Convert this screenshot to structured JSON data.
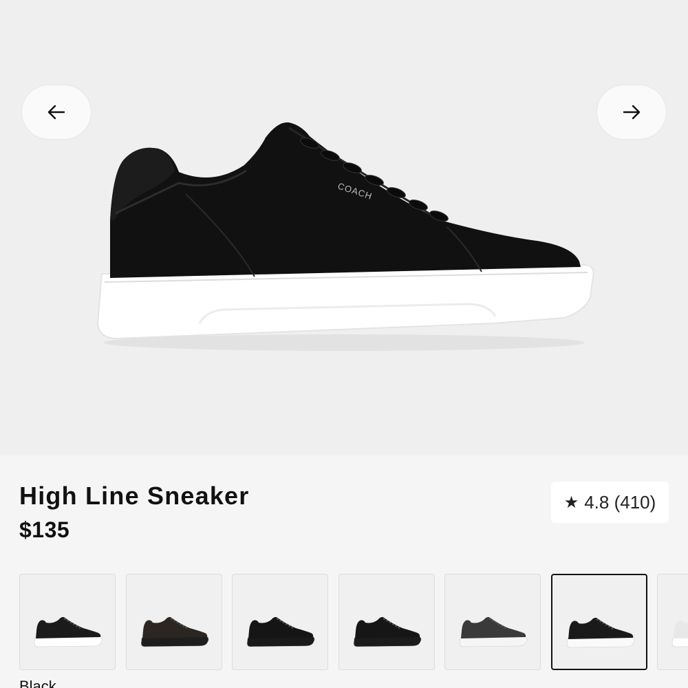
{
  "product": {
    "title": "High Line Sneaker",
    "price": "$135",
    "brand_mark": "COACH"
  },
  "rating": {
    "icon": "star-icon",
    "text": "4.8 (410)"
  },
  "gallery": {
    "prev_icon": "arrow-left-icon",
    "next_icon": "arrow-right-icon"
  },
  "swatches": {
    "selected_color_label": "Black",
    "items": [
      {
        "name": "black-floral",
        "upper": "#1b1b1b",
        "sole": "#ffffff"
      },
      {
        "name": "dark-brown",
        "upper": "#2b2622",
        "sole": "#1e1e1e"
      },
      {
        "name": "black-black-sole",
        "upper": "#151515",
        "sole": "#1a1a1a"
      },
      {
        "name": "black-2",
        "upper": "#161616",
        "sole": "#1c1c1c"
      },
      {
        "name": "charcoal",
        "upper": "#3a3a3a",
        "sole": "#f5f5f5"
      },
      {
        "name": "black-white-sole",
        "upper": "#1a1a1a",
        "sole": "#fafafa"
      },
      {
        "name": "white",
        "upper": "#e8e8e8",
        "sole": "#ffffff"
      }
    ]
  },
  "colors": {
    "hero_bg": "#efefef",
    "page_bg": "#f5f5f5",
    "selected_border": "#111111"
  }
}
